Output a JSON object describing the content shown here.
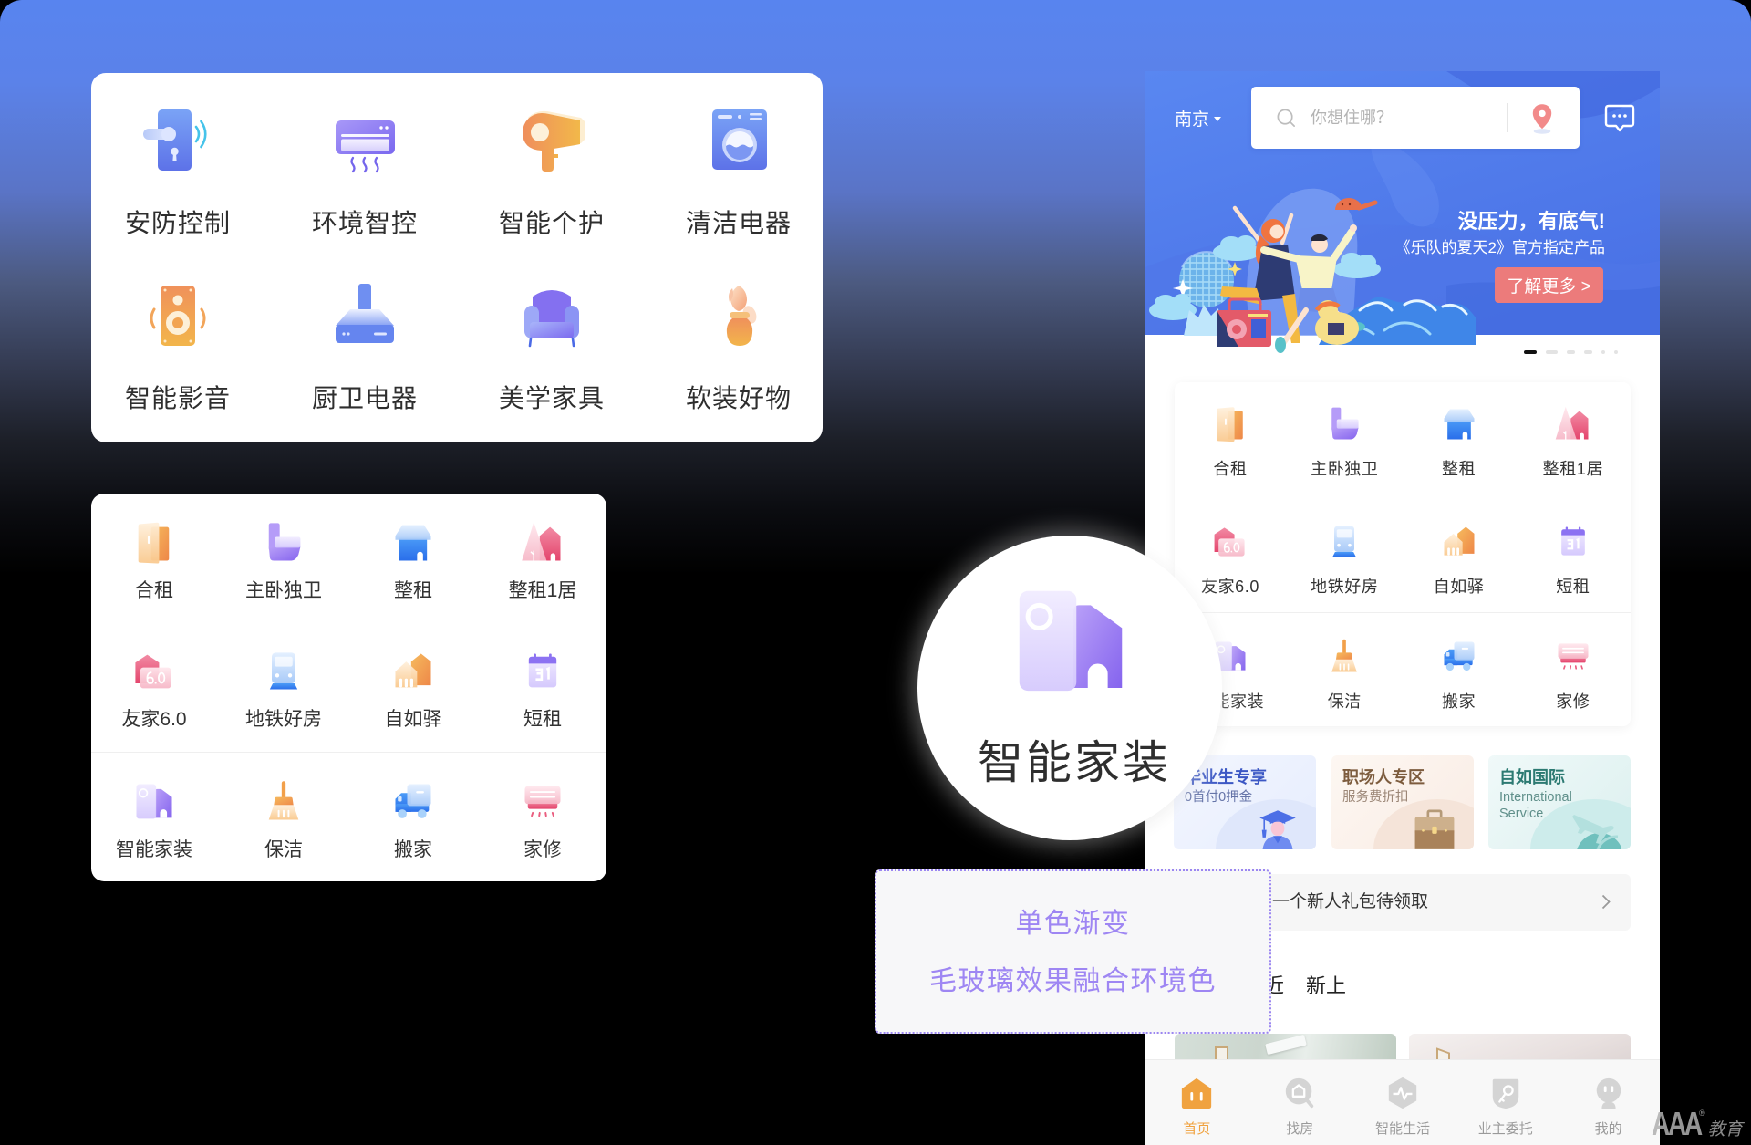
{
  "theme": {
    "page_top": "#5884ef",
    "banner_blue": "#4f7be9",
    "accent": "#f0a23f",
    "cta": "#ec7b7b",
    "annotation": "#9e86f3"
  },
  "home_appliance_card": {
    "items": [
      {
        "label": "安防控制",
        "icon": "smart-lock-icon"
      },
      {
        "label": "环境智控",
        "icon": "air-conditioner-icon"
      },
      {
        "label": "智能个护",
        "icon": "hair-dryer-icon"
      },
      {
        "label": "清洁电器",
        "icon": "washing-machine-icon"
      },
      {
        "label": "智能影音",
        "icon": "speaker-icon"
      },
      {
        "label": "厨卫电器",
        "icon": "range-hood-icon"
      },
      {
        "label": "美学家具",
        "icon": "armchair-icon"
      },
      {
        "label": "软装好物",
        "icon": "flower-vase-icon"
      }
    ]
  },
  "rental_service_card": {
    "items": [
      {
        "label": "合租",
        "icon": "shared-door-icon"
      },
      {
        "label": "主卧独卫",
        "icon": "toilet-icon"
      },
      {
        "label": "整租",
        "icon": "house-icon"
      },
      {
        "label": "整租1居",
        "icon": "house-tree-icon"
      },
      {
        "label": "友家6.0",
        "icon": "house-badge-icon"
      },
      {
        "label": "地铁好房",
        "icon": "subway-train-icon"
      },
      {
        "label": "自如驿",
        "icon": "twin-houses-icon"
      },
      {
        "label": "短租",
        "icon": "calendar-icon"
      },
      {
        "label": "智能家装",
        "icon": "door-house-icon"
      },
      {
        "label": "保洁",
        "icon": "broom-icon"
      },
      {
        "label": "搬家",
        "icon": "moving-truck-icon"
      },
      {
        "label": "家修",
        "icon": "repair-ac-icon"
      }
    ]
  },
  "phone": {
    "city": "南京",
    "search": {
      "placeholder": "你想住哪？"
    },
    "banner": {
      "title": "没压力，有底气!",
      "subtitle": "《乐队的夏天2》官方指定产品",
      "cta": "了解更多 >",
      "indicator": {
        "count": 6,
        "active": 0
      }
    },
    "service_grid": {
      "items": [
        {
          "label": "合租",
          "icon": "shared-door-icon"
        },
        {
          "label": "主卧独卫",
          "icon": "toilet-icon"
        },
        {
          "label": "整租",
          "icon": "house-icon"
        },
        {
          "label": "整租1居",
          "icon": "house-tree-icon"
        },
        {
          "label": "友家6.0",
          "icon": "house-badge-icon"
        },
        {
          "label": "地铁好房",
          "icon": "subway-train-icon"
        },
        {
          "label": "自如驿",
          "icon": "twin-houses-icon"
        },
        {
          "label": "短租",
          "icon": "calendar-icon"
        },
        {
          "label": "智能家装",
          "icon": "door-house-icon"
        },
        {
          "label": "保洁",
          "icon": "broom-icon"
        },
        {
          "label": "搬家",
          "icon": "moving-truck-icon"
        },
        {
          "label": "家修",
          "icon": "repair-ac-icon"
        }
      ]
    },
    "promos": [
      {
        "title": "毕业生专享",
        "subtitle": "0首付0押金",
        "icon": "graduate-icon"
      },
      {
        "title": "职场人专区",
        "subtitle": "服务费折扣",
        "icon": "briefcase-icon"
      },
      {
        "title": "自如国际",
        "subtitle": "International Service",
        "icon": "globe-plane-icon"
      }
    ],
    "gift_banner": {
      "text": "一个新人礼包待领取"
    },
    "tabs": [
      "近",
      "新上"
    ],
    "bottom_nav": [
      {
        "label": "首页",
        "icon": "home-icon",
        "active": true
      },
      {
        "label": "找房",
        "icon": "find-house-icon",
        "active": false
      },
      {
        "label": "智能生活",
        "icon": "smart-life-icon",
        "active": false
      },
      {
        "label": "业主委托",
        "icon": "owner-key-icon",
        "active": false
      },
      {
        "label": "我的",
        "icon": "profile-icon",
        "active": false
      }
    ]
  },
  "magnifier": {
    "label": "智能家装",
    "icon": "door-house-icon"
  },
  "annotation": {
    "lines": [
      "单色渐变",
      "毛玻璃效果融合环境色"
    ]
  },
  "watermark": {
    "brand": "AAA",
    "mark": "®",
    "suffix": "教育"
  }
}
